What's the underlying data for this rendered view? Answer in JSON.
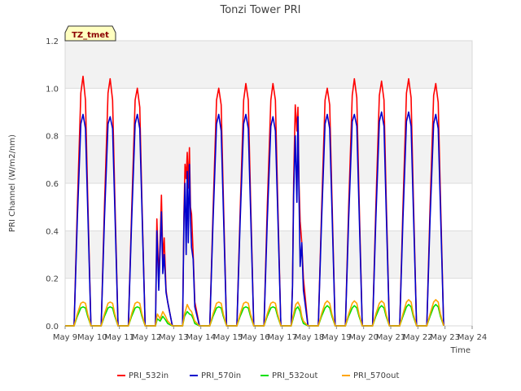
{
  "chart_data": {
    "type": "line",
    "title": "Tonzi Tower PRI",
    "xlabel": "Time",
    "ylabel": "PRI Channel (W/m2/nm)",
    "badge": "TZ_tmet",
    "ylim": [
      0.0,
      1.2
    ],
    "xlim": [
      9,
      24
    ],
    "y_ticks": [
      "0.0",
      "0.2",
      "0.4",
      "0.6",
      "0.8",
      "1.0",
      "1.2"
    ],
    "x_ticks": [
      "May 9",
      "May 10",
      "May 11",
      "May 12",
      "May 13",
      "May 14",
      "May 15",
      "May 16",
      "May 17",
      "May 18",
      "May 19",
      "May 20",
      "May 21",
      "May 22",
      "May 23",
      "May 24"
    ],
    "grid": true,
    "legend_position": "bottom",
    "x_unit": "day of May",
    "series": [
      {
        "name": "PRI_532in",
        "color": "#ff0000",
        "x": [
          9.0,
          9.33,
          9.45,
          9.58,
          9.66,
          9.75,
          9.83,
          9.95,
          10.33,
          10.45,
          10.58,
          10.66,
          10.75,
          10.83,
          10.95,
          11.33,
          11.45,
          11.58,
          11.66,
          11.75,
          11.83,
          11.95,
          12.33,
          12.38,
          12.45,
          12.5,
          12.55,
          12.6,
          12.65,
          12.72,
          12.78,
          12.95,
          13.33,
          13.38,
          13.42,
          13.46,
          13.5,
          13.54,
          13.58,
          13.62,
          13.66,
          13.72,
          13.78,
          13.95,
          14.33,
          14.45,
          14.58,
          14.66,
          14.75,
          14.83,
          14.95,
          15.33,
          15.45,
          15.58,
          15.66,
          15.75,
          15.83,
          15.95,
          16.33,
          16.45,
          16.58,
          16.66,
          16.75,
          16.83,
          16.95,
          17.33,
          17.38,
          17.42,
          17.48,
          17.54,
          17.58,
          17.62,
          17.66,
          17.72,
          17.78,
          17.95,
          18.33,
          18.45,
          18.58,
          18.66,
          18.75,
          18.83,
          18.95,
          19.33,
          19.45,
          19.58,
          19.66,
          19.75,
          19.83,
          19.95,
          20.33,
          20.45,
          20.58,
          20.66,
          20.75,
          20.83,
          20.95,
          21.33,
          21.45,
          21.58,
          21.66,
          21.75,
          21.83,
          21.95,
          22.33,
          22.45,
          22.58,
          22.66,
          22.75,
          22.83,
          22.95
        ],
        "y": [
          0.0,
          0.0,
          0.5,
          0.98,
          1.05,
          0.95,
          0.55,
          0.0,
          0.0,
          0.5,
          0.98,
          1.04,
          0.95,
          0.55,
          0.0,
          0.0,
          0.48,
          0.95,
          1.0,
          0.92,
          0.53,
          0.0,
          0.0,
          0.45,
          0.2,
          0.35,
          0.55,
          0.28,
          0.37,
          0.15,
          0.1,
          0.0,
          0.0,
          0.48,
          0.68,
          0.62,
          0.73,
          0.58,
          0.75,
          0.5,
          0.47,
          0.3,
          0.1,
          0.0,
          0.0,
          0.48,
          0.95,
          1.0,
          0.93,
          0.55,
          0.0,
          0.0,
          0.48,
          0.95,
          1.02,
          0.95,
          0.55,
          0.0,
          0.0,
          0.5,
          0.95,
          1.02,
          0.95,
          0.55,
          0.0,
          0.0,
          0.17,
          0.6,
          0.93,
          0.82,
          0.92,
          0.6,
          0.44,
          0.35,
          0.2,
          0.0,
          0.0,
          0.48,
          0.95,
          1.0,
          0.93,
          0.55,
          0.0,
          0.0,
          0.5,
          0.97,
          1.04,
          0.96,
          0.55,
          0.0,
          0.0,
          0.5,
          0.97,
          1.03,
          0.95,
          0.55,
          0.0,
          0.0,
          0.5,
          0.98,
          1.04,
          0.96,
          0.55,
          0.0,
          0.0,
          0.5,
          0.97,
          1.02,
          0.94,
          0.55,
          0.0
        ]
      },
      {
        "name": "PRI_570in",
        "color": "#0000cc",
        "x": [
          9.0,
          9.33,
          9.45,
          9.58,
          9.66,
          9.75,
          9.83,
          9.95,
          10.33,
          10.45,
          10.58,
          10.66,
          10.75,
          10.83,
          10.95,
          11.33,
          11.45,
          11.58,
          11.66,
          11.75,
          11.83,
          11.95,
          12.33,
          12.38,
          12.45,
          12.5,
          12.55,
          12.6,
          12.65,
          12.72,
          12.78,
          12.95,
          13.33,
          13.38,
          13.42,
          13.46,
          13.5,
          13.54,
          13.58,
          13.62,
          13.66,
          13.72,
          13.78,
          13.95,
          14.33,
          14.45,
          14.58,
          14.66,
          14.75,
          14.83,
          14.95,
          15.33,
          15.45,
          15.58,
          15.66,
          15.75,
          15.83,
          15.95,
          16.33,
          16.45,
          16.58,
          16.66,
          16.75,
          16.83,
          16.95,
          17.33,
          17.38,
          17.42,
          17.48,
          17.54,
          17.58,
          17.62,
          17.66,
          17.72,
          17.78,
          17.95,
          18.33,
          18.45,
          18.58,
          18.66,
          18.75,
          18.83,
          18.95,
          19.33,
          19.45,
          19.58,
          19.66,
          19.75,
          19.83,
          19.95,
          20.33,
          20.45,
          20.58,
          20.66,
          20.75,
          20.83,
          20.95,
          21.33,
          21.45,
          21.58,
          21.66,
          21.75,
          21.83,
          21.95,
          22.33,
          22.45,
          22.58,
          22.66,
          22.75,
          22.83,
          22.95
        ],
        "y": [
          0.0,
          0.0,
          0.45,
          0.85,
          0.89,
          0.83,
          0.5,
          0.0,
          0.0,
          0.45,
          0.85,
          0.88,
          0.83,
          0.5,
          0.0,
          0.0,
          0.44,
          0.85,
          0.89,
          0.83,
          0.5,
          0.0,
          0.0,
          0.4,
          0.15,
          0.32,
          0.48,
          0.22,
          0.3,
          0.14,
          0.1,
          0.0,
          0.0,
          0.45,
          0.6,
          0.3,
          0.65,
          0.35,
          0.68,
          0.45,
          0.33,
          0.28,
          0.08,
          0.0,
          0.0,
          0.44,
          0.85,
          0.89,
          0.82,
          0.5,
          0.0,
          0.0,
          0.44,
          0.85,
          0.89,
          0.83,
          0.5,
          0.0,
          0.0,
          0.44,
          0.84,
          0.88,
          0.82,
          0.5,
          0.0,
          0.0,
          0.16,
          0.55,
          0.8,
          0.52,
          0.88,
          0.55,
          0.25,
          0.35,
          0.15,
          0.0,
          0.0,
          0.44,
          0.85,
          0.89,
          0.83,
          0.5,
          0.0,
          0.0,
          0.45,
          0.86,
          0.89,
          0.84,
          0.5,
          0.0,
          0.0,
          0.45,
          0.86,
          0.9,
          0.84,
          0.5,
          0.0,
          0.0,
          0.45,
          0.86,
          0.9,
          0.84,
          0.5,
          0.0,
          0.0,
          0.45,
          0.85,
          0.89,
          0.83,
          0.5,
          0.0
        ]
      },
      {
        "name": "PRI_532out",
        "color": "#00e000",
        "x": [
          9.0,
          9.33,
          9.45,
          9.58,
          9.66,
          9.75,
          9.83,
          9.95,
          10.33,
          10.45,
          10.58,
          10.66,
          10.75,
          10.83,
          10.95,
          11.33,
          11.45,
          11.58,
          11.66,
          11.75,
          11.83,
          11.95,
          12.33,
          12.4,
          12.5,
          12.6,
          12.7,
          12.78,
          12.95,
          13.33,
          13.4,
          13.5,
          13.58,
          13.66,
          13.72,
          13.78,
          13.95,
          14.33,
          14.45,
          14.58,
          14.66,
          14.75,
          14.83,
          14.95,
          15.33,
          15.45,
          15.58,
          15.66,
          15.75,
          15.83,
          15.95,
          16.33,
          16.45,
          16.58,
          16.66,
          16.75,
          16.83,
          16.95,
          17.33,
          17.4,
          17.5,
          17.58,
          17.66,
          17.72,
          17.78,
          17.95,
          18.33,
          18.45,
          18.58,
          18.66,
          18.75,
          18.83,
          18.95,
          19.33,
          19.45,
          19.58,
          19.66,
          19.75,
          19.83,
          19.95,
          20.33,
          20.45,
          20.58,
          20.66,
          20.75,
          20.83,
          20.95,
          21.33,
          21.45,
          21.58,
          21.66,
          21.75,
          21.83,
          21.95,
          22.33,
          22.45,
          22.58,
          22.66,
          22.75,
          22.83,
          22.95
        ],
        "y": [
          0.0,
          0.0,
          0.04,
          0.075,
          0.08,
          0.075,
          0.04,
          0.0,
          0.0,
          0.04,
          0.075,
          0.08,
          0.075,
          0.04,
          0.0,
          0.0,
          0.04,
          0.075,
          0.08,
          0.075,
          0.04,
          0.0,
          0.0,
          0.03,
          0.02,
          0.04,
          0.025,
          0.01,
          0.0,
          0.0,
          0.04,
          0.06,
          0.05,
          0.045,
          0.03,
          0.01,
          0.0,
          0.0,
          0.04,
          0.075,
          0.08,
          0.075,
          0.04,
          0.0,
          0.0,
          0.04,
          0.075,
          0.08,
          0.075,
          0.04,
          0.0,
          0.0,
          0.04,
          0.075,
          0.08,
          0.075,
          0.04,
          0.0,
          0.0,
          0.03,
          0.07,
          0.08,
          0.06,
          0.03,
          0.01,
          0.0,
          0.0,
          0.04,
          0.075,
          0.085,
          0.075,
          0.04,
          0.0,
          0.0,
          0.04,
          0.075,
          0.085,
          0.075,
          0.04,
          0.0,
          0.0,
          0.04,
          0.075,
          0.085,
          0.075,
          0.04,
          0.0,
          0.0,
          0.04,
          0.08,
          0.09,
          0.08,
          0.04,
          0.0,
          0.0,
          0.04,
          0.08,
          0.09,
          0.08,
          0.04,
          0.0
        ]
      },
      {
        "name": "PRI_570out",
        "color": "#ffa500",
        "x": [
          9.0,
          9.33,
          9.45,
          9.58,
          9.66,
          9.75,
          9.83,
          9.95,
          10.33,
          10.45,
          10.58,
          10.66,
          10.75,
          10.83,
          10.95,
          11.33,
          11.45,
          11.58,
          11.66,
          11.75,
          11.83,
          11.95,
          12.33,
          12.4,
          12.5,
          12.6,
          12.7,
          12.78,
          12.95,
          13.33,
          13.4,
          13.5,
          13.58,
          13.66,
          13.72,
          13.78,
          13.95,
          14.33,
          14.45,
          14.58,
          14.66,
          14.75,
          14.83,
          14.95,
          15.33,
          15.45,
          15.58,
          15.66,
          15.75,
          15.83,
          15.95,
          16.33,
          16.45,
          16.58,
          16.66,
          16.75,
          16.83,
          16.95,
          17.33,
          17.4,
          17.5,
          17.58,
          17.66,
          17.72,
          17.78,
          17.95,
          18.33,
          18.45,
          18.58,
          18.66,
          18.75,
          18.83,
          18.95,
          19.33,
          19.45,
          19.58,
          19.66,
          19.75,
          19.83,
          19.95,
          20.33,
          20.45,
          20.58,
          20.66,
          20.75,
          20.83,
          20.95,
          21.33,
          21.45,
          21.58,
          21.66,
          21.75,
          21.83,
          21.95,
          22.33,
          22.45,
          22.58,
          22.66,
          22.75,
          22.83,
          22.95
        ],
        "y": [
          0.0,
          0.0,
          0.05,
          0.095,
          0.1,
          0.095,
          0.05,
          0.0,
          0.0,
          0.05,
          0.095,
          0.1,
          0.095,
          0.05,
          0.0,
          0.0,
          0.05,
          0.095,
          0.1,
          0.095,
          0.05,
          0.0,
          0.0,
          0.05,
          0.03,
          0.06,
          0.04,
          0.02,
          0.0,
          0.0,
          0.05,
          0.09,
          0.07,
          0.06,
          0.04,
          0.02,
          0.0,
          0.0,
          0.05,
          0.095,
          0.1,
          0.095,
          0.05,
          0.0,
          0.0,
          0.05,
          0.095,
          0.1,
          0.095,
          0.05,
          0.0,
          0.0,
          0.05,
          0.095,
          0.1,
          0.095,
          0.05,
          0.0,
          0.0,
          0.04,
          0.09,
          0.1,
          0.08,
          0.04,
          0.02,
          0.0,
          0.0,
          0.05,
          0.095,
          0.105,
          0.095,
          0.05,
          0.0,
          0.0,
          0.05,
          0.095,
          0.105,
          0.095,
          0.05,
          0.0,
          0.0,
          0.05,
          0.095,
          0.105,
          0.095,
          0.05,
          0.0,
          0.0,
          0.05,
          0.1,
          0.11,
          0.1,
          0.05,
          0.0,
          0.0,
          0.05,
          0.1,
          0.11,
          0.1,
          0.05,
          0.0
        ]
      }
    ]
  }
}
